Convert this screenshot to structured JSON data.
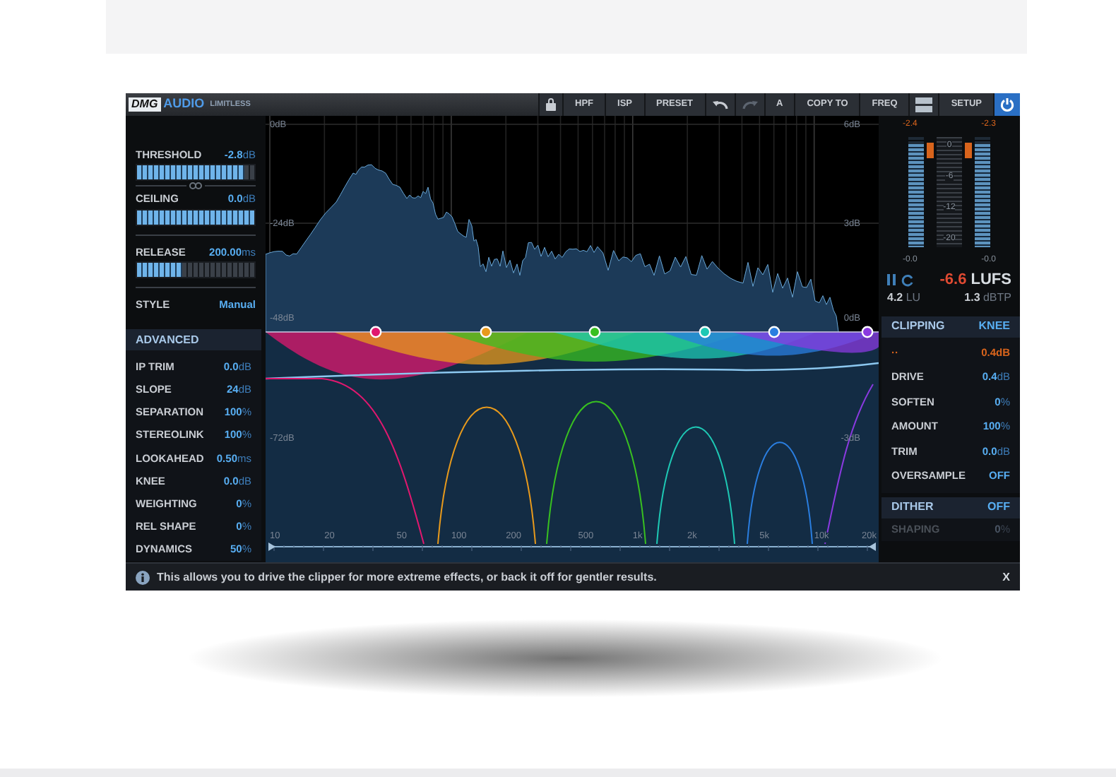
{
  "header": {
    "brand": "DMG",
    "brand_word": "AUDIO",
    "product": "LIMITLESS",
    "toolbar": [
      {
        "kind": "lock"
      },
      {
        "kind": "text",
        "label": "HPF"
      },
      {
        "kind": "text",
        "label": "ISP"
      },
      {
        "kind": "text",
        "label": "PRESET"
      },
      {
        "kind": "undo"
      },
      {
        "kind": "redo"
      },
      {
        "kind": "text",
        "label": "A"
      },
      {
        "kind": "text",
        "label": "COPY TO"
      },
      {
        "kind": "text",
        "label": "FREQ"
      },
      {
        "kind": "layout"
      },
      {
        "kind": "text",
        "label": "SETUP"
      },
      {
        "kind": "power",
        "on": true
      }
    ]
  },
  "limiter": {
    "controls": [
      {
        "label": "THRESHOLD",
        "value": "-2.8",
        "unit": "dB",
        "level": 0.92
      },
      {
        "label": "CEILING",
        "value": "0.0",
        "unit": "dB",
        "level": 1
      },
      {
        "label": "RELEASE",
        "value": "200.00",
        "unit": "ms",
        "level": 0.38
      }
    ],
    "linked": true,
    "style": {
      "label": "STYLE",
      "value": "Manual"
    }
  },
  "advanced": {
    "title": "ADVANCED",
    "rows": [
      {
        "label": "IP TRIM",
        "value": "0.0",
        "unit": "dB"
      },
      {
        "label": "SLOPE",
        "value": "24",
        "unit": "dB"
      },
      {
        "label": "SEPARATION",
        "value": "100",
        "unit": "%"
      },
      {
        "label": "STEREOLINK",
        "value": "100",
        "unit": "%"
      },
      {
        "label": "LOOKAHEAD",
        "value": "0.50",
        "unit": "ms"
      },
      {
        "label": "KNEE",
        "value": "0.0",
        "unit": "dB"
      },
      {
        "label": "WEIGHTING",
        "value": "0",
        "unit": "%"
      },
      {
        "label": "REL SHAPE",
        "value": "0",
        "unit": "%"
      },
      {
        "label": "DYNAMICS",
        "value": "50",
        "unit": "%"
      }
    ]
  },
  "chart": {
    "left_axis": [
      "0dB",
      "-24dB",
      "-48dB",
      "-72dB"
    ],
    "right_axis": [
      "6dB",
      "3dB",
      "0dB",
      "-3dB"
    ],
    "freq_labels": [
      "10",
      "20",
      "50",
      "100",
      "200",
      "500",
      "1k",
      "2k",
      "5k",
      "10k",
      "20k"
    ],
    "bands": [
      {
        "color": "#e0186f"
      },
      {
        "color": "#e89a1c"
      },
      {
        "color": "#38c020"
      },
      {
        "color": "#1ec8b4"
      },
      {
        "color": "#2a7ee0"
      },
      {
        "color": "#8a3ae0"
      }
    ]
  },
  "meters": {
    "peaks": [
      "-2.4",
      "-2.3"
    ],
    "scale": [
      "0",
      "-6",
      "-12",
      "-20"
    ],
    "readings": [
      "-0.0",
      "-0.0"
    ],
    "channels": [
      {
        "level": 0.93
      },
      {
        "level": 0.93
      }
    ]
  },
  "loudness": {
    "value": "-6.6",
    "unit": "LUFS",
    "lu": "4.2",
    "lu_unit": "LU",
    "tp": "1.3",
    "tp_unit": "dBTP"
  },
  "clipping": {
    "title": "CLIPPING",
    "mode": "KNEE",
    "rows": [
      {
        "kind": "alert",
        "label": "··",
        "value": "0.4dB"
      },
      {
        "kind": "param",
        "label": "DRIVE",
        "value": "0.4",
        "unit": "dB"
      },
      {
        "kind": "param",
        "label": "SOFTEN",
        "value": "0",
        "unit": "%"
      },
      {
        "kind": "param",
        "label": "AMOUNT",
        "value": "100",
        "unit": "%"
      },
      {
        "kind": "param",
        "label": "TRIM",
        "value": "0.0",
        "unit": "dB"
      },
      {
        "kind": "param",
        "label": "OVERSAMPLE",
        "value": "OFF"
      }
    ]
  },
  "dither": {
    "title": "DITHER",
    "value": "OFF",
    "rows": [
      {
        "label": "SHAPING",
        "value": "0",
        "unit": "%",
        "disabled": true
      }
    ]
  },
  "info": {
    "text": "This allows you to drive the clipper for more extreme effects, or back it off for gentler results.",
    "close": "X"
  }
}
